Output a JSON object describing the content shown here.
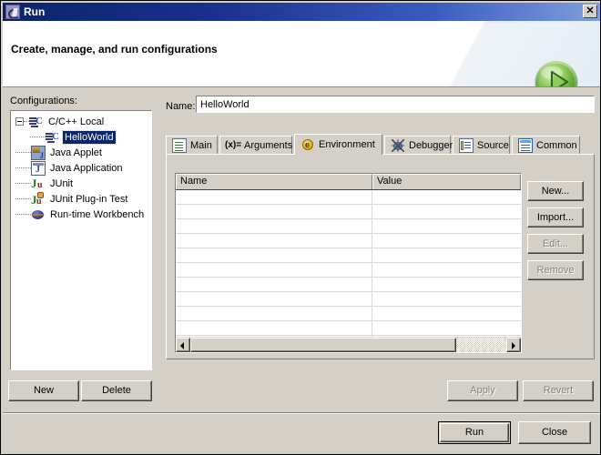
{
  "window": {
    "title": "Run",
    "icon": "eclipse-run-icon",
    "close_label": "✕"
  },
  "header": {
    "title": "Create, manage, and run configurations",
    "banner_icon": "green-run-play-icon",
    "accent_color": "#6cbf3e"
  },
  "configurations": {
    "label": "Configurations:",
    "tree": [
      {
        "label": "C/C++ Local",
        "icon": "c-cpp-local-icon",
        "indent": 0,
        "expander": "minus",
        "selected": false
      },
      {
        "label": "HelloWorld",
        "icon": "c-cpp-config-icon",
        "indent": 1,
        "expander": "none",
        "selected": true
      },
      {
        "label": "Java Applet",
        "icon": "java-applet-icon",
        "indent": 0,
        "expander": "none",
        "selected": false
      },
      {
        "label": "Java Application",
        "icon": "java-application-icon",
        "indent": 0,
        "expander": "none",
        "selected": false
      },
      {
        "label": "JUnit",
        "icon": "junit-icon",
        "indent": 0,
        "expander": "none",
        "selected": false
      },
      {
        "label": "JUnit Plug-in Test",
        "icon": "junit-plugin-icon",
        "indent": 0,
        "expander": "none",
        "selected": false
      },
      {
        "label": "Run-time Workbench",
        "icon": "runtime-workbench-icon",
        "indent": 0,
        "expander": "none",
        "selected": false
      }
    ],
    "new_label": "New",
    "delete_label": "Delete"
  },
  "name_field": {
    "label": "Name:",
    "value": "HelloWorld",
    "placeholder": ""
  },
  "tabs": [
    {
      "label": "Main",
      "icon": "main-document-icon",
      "selected": false
    },
    {
      "label": "Arguments",
      "icon": "arguments-xeq-icon",
      "selected": false
    },
    {
      "label": "Environment",
      "icon": "environment-e-icon",
      "selected": true
    },
    {
      "label": "Debugger",
      "icon": "debugger-bug-icon",
      "selected": false
    },
    {
      "label": "Source",
      "icon": "source-page-icon",
      "selected": false
    },
    {
      "label": "Common",
      "icon": "common-list-icon",
      "selected": false
    }
  ],
  "environment_table": {
    "columns": [
      "Name",
      "Value"
    ],
    "rows": [],
    "empty_row_count": 11,
    "scroll_position": 0
  },
  "environment_buttons": [
    {
      "label": "New...",
      "name": "env-new-button",
      "enabled": true
    },
    {
      "label": "Import...",
      "label_id": "import",
      "enabled": true
    },
    {
      "label": "Edit...",
      "enabled": false
    },
    {
      "label": "Remove",
      "enabled": false
    }
  ],
  "form_buttons": {
    "apply_label": "Apply",
    "apply_enabled": false,
    "revert_label": "Revert",
    "revert_enabled": false
  },
  "footer": {
    "run_label": "Run",
    "run_is_default": true,
    "close_label": "Close"
  }
}
